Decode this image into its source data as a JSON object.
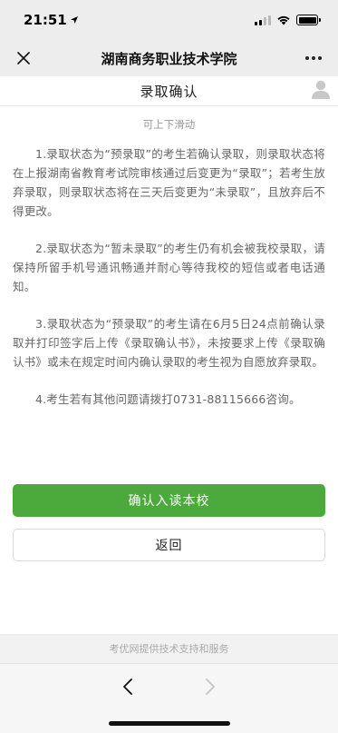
{
  "status_bar": {
    "time": "21:51"
  },
  "nav": {
    "title": "湖南商务职业技术学院"
  },
  "page": {
    "title": "录取确认",
    "hint": "可上下滑动",
    "notes": [
      "1.录取状态为“预录取”的考生若确认录取，则录取状态将在上报湖南省教育考试院审核通过后变更为“录取”；若考生放弃录取，则录取状态将在三天后变更为“未录取”，且放弃后不得更改。",
      "2.录取状态为“暂未录取”的考生仍有机会被我校录取，请保持所留手机号通讯畅通并耐心等待我校的短信或者电话通知。",
      "3.录取状态为“预录取”的考生请在6月5日24点前确认录取并打印签字后上传《录取确认书》，未按要求上传《录取确认书》或未在规定时间内确认录取的考生视为自愿放弃录取。",
      "4.考生若有其他问题请拨打0731-88115666咨询。"
    ],
    "confirm_label": "确认入读本校",
    "back_label": "返回"
  },
  "footer": {
    "text": "考优网提供技术支持和服务"
  },
  "colors": {
    "primary_green": "#4caa3d",
    "background": "#ededed"
  },
  "icons": {
    "close": "close-icon",
    "more": "more-icon",
    "avatar": "user-avatar-icon",
    "back": "chevron-left-icon",
    "forward": "chevron-right-icon"
  }
}
